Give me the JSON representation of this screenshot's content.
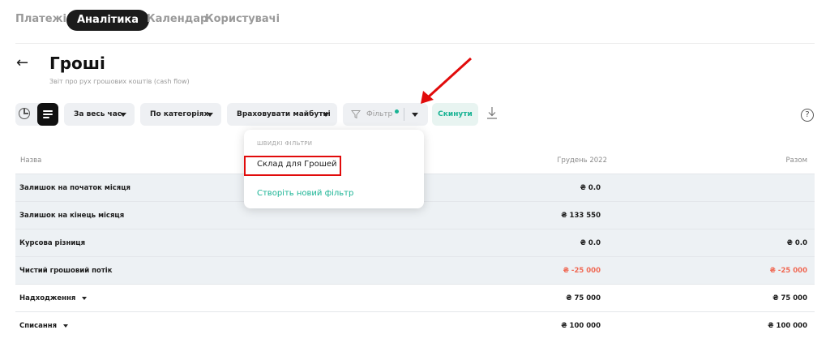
{
  "nav": {
    "tabs": [
      {
        "label": "Платежі"
      },
      {
        "label": "Аналітика"
      },
      {
        "label": "Календар"
      },
      {
        "label": "Користувачі"
      }
    ]
  },
  "page": {
    "title": "Гроші",
    "subtitle": "Звіт про рух грошових коштів (cash flow)"
  },
  "toolbar": {
    "period_label": "За весь час",
    "grouping_label": "По категоріях",
    "future_label": "Враховувати майбутні",
    "filter_label": "Фільтр",
    "reset_label": "Скинути",
    "accent_color": "#19b394"
  },
  "dropdown": {
    "heading": "ШВИДКІ ФІЛЬТРИ",
    "options": [
      {
        "label": "Склад для Грошей"
      },
      {
        "label": "Створіть новий фільтр"
      }
    ]
  },
  "table": {
    "headers": {
      "name": "Назва",
      "month": "Грудень 2022",
      "total": "Разом"
    },
    "rows": [
      {
        "name": "Залишок на початок місяця",
        "month": "₴ 0.0",
        "total": ""
      },
      {
        "name": "Залишок на кінець місяця",
        "month": "₴ 133 550",
        "total": ""
      },
      {
        "name": "Курсова різниця",
        "month": "₴ 0.0",
        "total": "₴ 0.0"
      },
      {
        "name": "Чистий грошовий потік",
        "month": "₴ -25 000",
        "total": "₴ -25 000"
      },
      {
        "name": "Надходження",
        "month": "₴ 75 000",
        "total": "₴ 75 000"
      },
      {
        "name": "Списання",
        "month": "₴ 100 000",
        "total": "₴ 100 000"
      }
    ],
    "negative_color": "#f06a55"
  }
}
